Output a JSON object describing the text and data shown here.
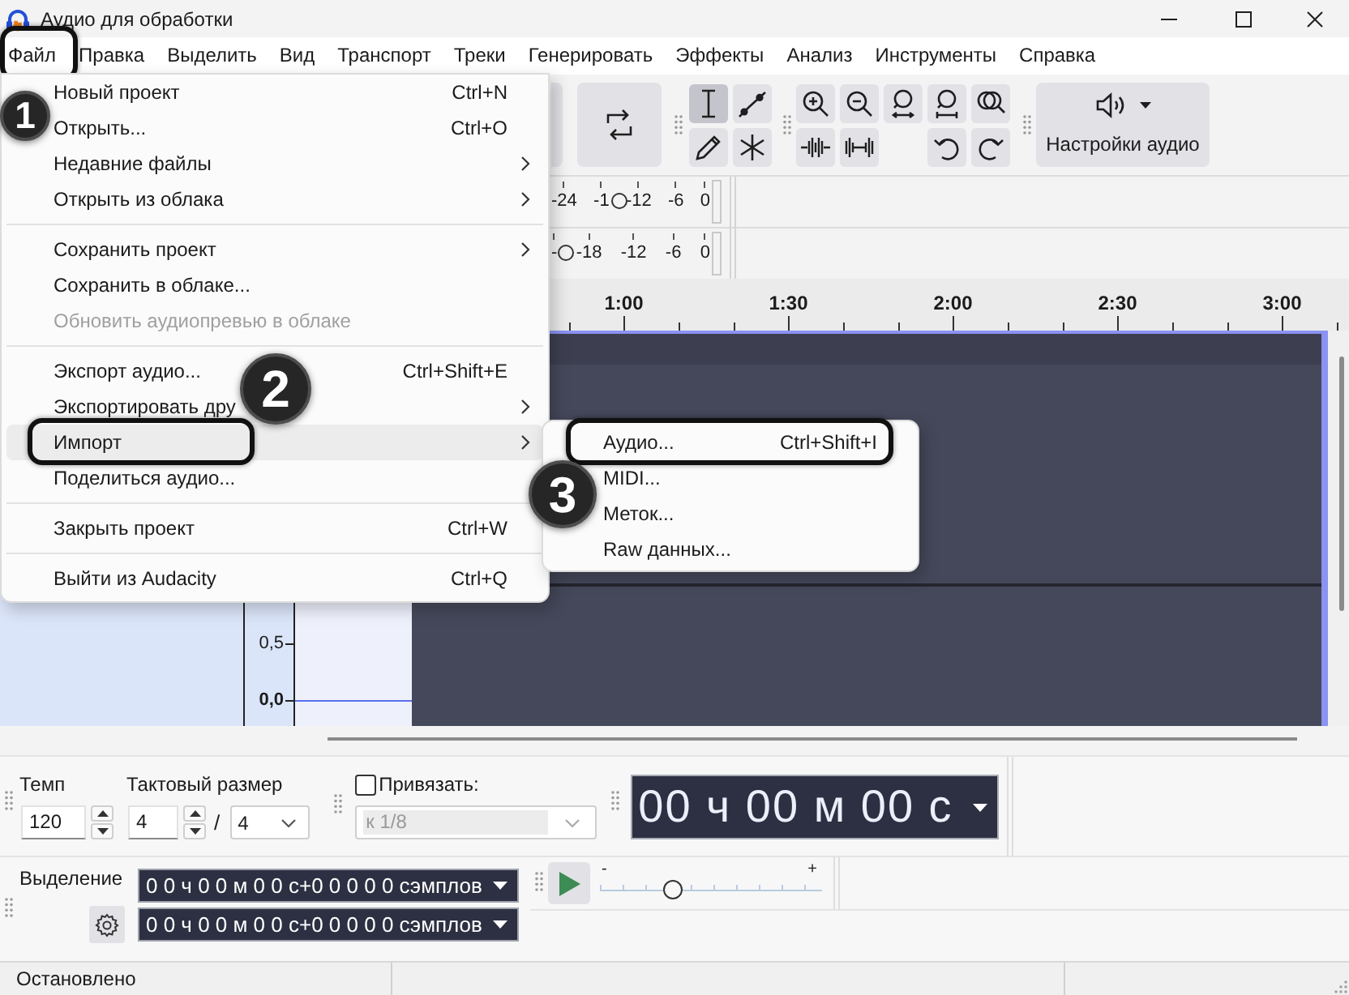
{
  "window": {
    "title": "Аудио для обработки"
  },
  "menu_bar": [
    {
      "label": "Файл",
      "badge": "1"
    },
    {
      "label": "Правка"
    },
    {
      "label": "Выделить"
    },
    {
      "label": "Вид"
    },
    {
      "label": "Транспорт"
    },
    {
      "label": "Треки"
    },
    {
      "label": "Генерировать"
    },
    {
      "label": "Эффекты"
    },
    {
      "label": "Анализ"
    },
    {
      "label": "Инструменты"
    },
    {
      "label": "Справка"
    }
  ],
  "tools": [
    {
      "kind": "select",
      "selected": true
    },
    {
      "kind": "envelope",
      "selected": false
    },
    {
      "kind": "draw",
      "selected": false
    },
    {
      "kind": "multi",
      "selected": false
    }
  ],
  "audio_setup": {
    "label": "Настройки аудио"
  },
  "meters": [
    {
      "labels": [
        "-24",
        "-1",
        "-12",
        "-6",
        "0"
      ],
      "level": 0.43
    },
    {
      "labels": [
        "-",
        "-18",
        "-12",
        "-6",
        "0"
      ],
      "level": 0.07
    }
  ],
  "ruler": {
    "labels": [
      "1:00",
      "1:30",
      "2:00",
      "2:30",
      "3:00"
    ]
  },
  "track": {
    "scale": [
      "0,5",
      "0,0"
    ]
  },
  "tempo": {
    "label": "Темп",
    "value": "120"
  },
  "time_signature": {
    "label": "Тактовый размер",
    "upper": "4",
    "separator": "/",
    "lower": "4"
  },
  "snap": {
    "label": "Привязать:",
    "checked": false,
    "value": "к 1/8",
    "disabled": true
  },
  "time_display": {
    "value": "00 ч 00 м 00 с"
  },
  "selection": {
    "label": "Выделение",
    "start": "0 0 ч 0 0 м 0 0 с+0 0 0 0 0 сэмплов",
    "end": "0 0 ч 0 0 м 0 0 с+0 0 0 0 0 сэмплов"
  },
  "play_volume": {
    "min_label": "-",
    "max_label": "+",
    "level": 0.31
  },
  "status_bar": {
    "text": "Остановлено"
  },
  "file_menu": [
    {
      "kind": "item",
      "label": "Новый проект",
      "shortcut": "Ctrl+N",
      "submenu": false,
      "disabled": false,
      "selected": false
    },
    {
      "kind": "item",
      "label": "Открыть...",
      "shortcut": "Ctrl+O",
      "submenu": false,
      "disabled": false,
      "selected": false
    },
    {
      "kind": "item",
      "label": "Недавние файлы",
      "submenu": true,
      "disabled": false,
      "selected": false
    },
    {
      "kind": "item",
      "label": "Открыть из облака",
      "submenu": true,
      "disabled": false,
      "selected": false
    },
    {
      "kind": "separator"
    },
    {
      "kind": "item",
      "label": "Сохранить проект",
      "submenu": true,
      "disabled": false,
      "selected": false
    },
    {
      "kind": "item",
      "label": "Сохранить в облаке...",
      "submenu": false,
      "disabled": false,
      "selected": false
    },
    {
      "kind": "item",
      "label": "Обновить аудиопревью в облаке",
      "submenu": false,
      "disabled": true,
      "selected": false
    },
    {
      "kind": "separator"
    },
    {
      "kind": "item",
      "label": "Экспорт аудио...",
      "shortcut": "Ctrl+Shift+E",
      "submenu": false,
      "disabled": false,
      "selected": false
    },
    {
      "kind": "item",
      "label": "Экспортировать дру",
      "submenu": true,
      "disabled": false,
      "selected": false
    },
    {
      "kind": "item",
      "label": "Импорт",
      "submenu": true,
      "disabled": false,
      "selected": true,
      "badge": "2"
    },
    {
      "kind": "item",
      "label": "Поделиться аудио...",
      "submenu": false,
      "disabled": false,
      "selected": false
    },
    {
      "kind": "separator"
    },
    {
      "kind": "item",
      "label": "Закрыть проект",
      "shortcut": "Ctrl+W",
      "submenu": false,
      "disabled": false,
      "selected": false
    },
    {
      "kind": "separator"
    },
    {
      "kind": "item",
      "label": "Выйти из Audacity",
      "shortcut": "Ctrl+Q",
      "submenu": false,
      "disabled": false,
      "selected": false
    }
  ],
  "import_submenu": [
    {
      "label": "Аудио...",
      "shortcut": "Ctrl+Shift+I",
      "selected": false,
      "badge": "3"
    },
    {
      "label": "MIDI...",
      "selected": false
    },
    {
      "label": "Меток...",
      "selected": false
    },
    {
      "label": "Raw данных...",
      "selected": false
    }
  ]
}
